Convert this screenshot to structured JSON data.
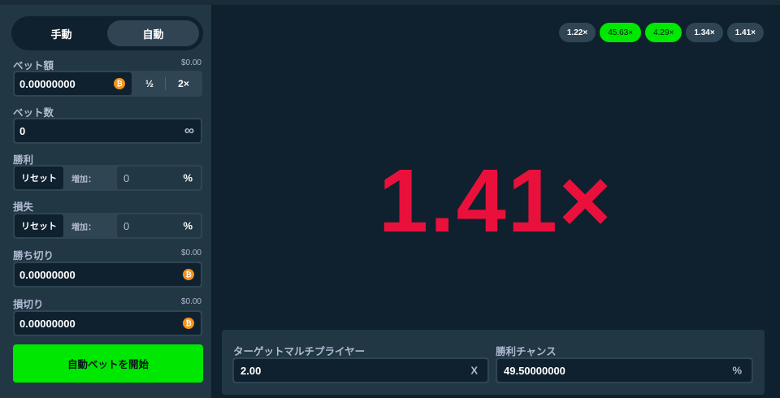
{
  "mode_tabs": {
    "manual": "手動",
    "auto": "自動",
    "active": "auto"
  },
  "bet_amount": {
    "label": "ベット額",
    "usd": "$0.00",
    "value": "0.00000000",
    "half_label": "½",
    "double_label": "2×"
  },
  "bet_count": {
    "label": "ベット数",
    "value": "0",
    "infinity_symbol": "∞"
  },
  "on_win": {
    "label": "勝利",
    "reset_label": "リセット",
    "increase_label": "増加：",
    "value": "0",
    "unit": "%"
  },
  "on_loss": {
    "label": "損失",
    "reset_label": "リセット",
    "increase_label": "増加：",
    "value": "0",
    "unit": "%"
  },
  "stop_on_profit": {
    "label": "勝ち切り",
    "usd": "$0.00",
    "value": "0.00000000"
  },
  "stop_on_loss": {
    "label": "損切り",
    "usd": "$0.00",
    "value": "0.00000000"
  },
  "start_button": "自動ベットを開始",
  "history": [
    {
      "label": "1.22×",
      "win": false
    },
    {
      "label": "45.63×",
      "win": true
    },
    {
      "label": "4.29×",
      "win": true
    },
    {
      "label": "1.34×",
      "win": false
    },
    {
      "label": "1.41×",
      "win": false
    }
  ],
  "result": "1.41×",
  "target_multiplier": {
    "label": "ターゲットマルチプライヤー",
    "value": "2.00",
    "suffix": "X"
  },
  "win_chance": {
    "label": "勝利チャンス",
    "value": "49.50000000",
    "suffix": "%"
  },
  "icons": {
    "coin": "bitcoin-icon",
    "infinity": "infinity-icon"
  },
  "colors": {
    "accent_green": "#00e701",
    "result_red": "#e9113c",
    "background": "#0f212e",
    "panel": "#213743"
  }
}
